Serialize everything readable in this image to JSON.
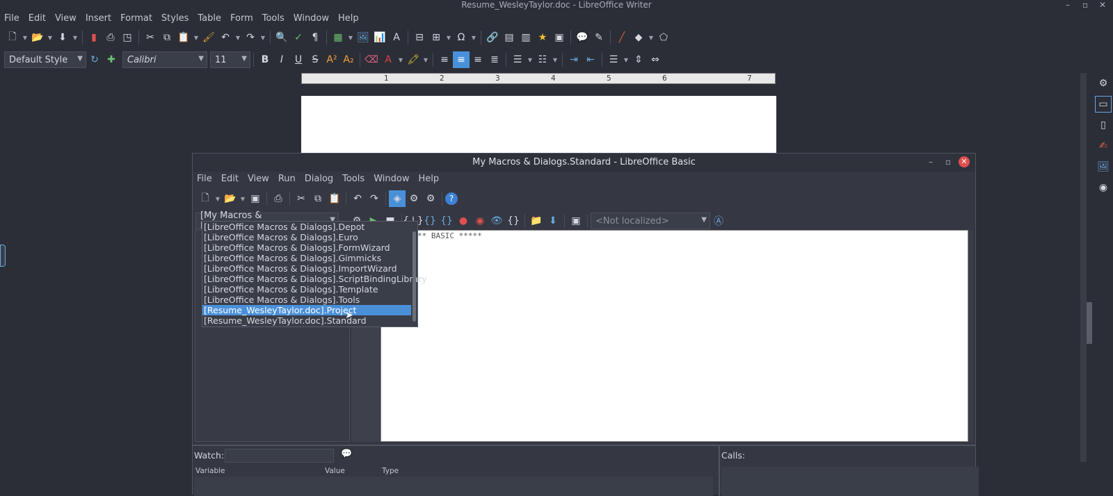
{
  "writer": {
    "title": "Resume_WesleyTaylor.doc - LibreOffice Writer",
    "menu": [
      "File",
      "Edit",
      "View",
      "Insert",
      "Format",
      "Styles",
      "Table",
      "Form",
      "Tools",
      "Window",
      "Help"
    ],
    "style_value": "Default Style",
    "font_value": "Calibri",
    "size_value": "11",
    "ruler_numbers": [
      "1",
      "2",
      "3",
      "4",
      "5",
      "6",
      "7"
    ],
    "window_controls": [
      "–",
      "▫",
      "✕"
    ]
  },
  "basic_ide": {
    "title": "My Macros & Dialogs.Standard - LibreOffice Basic",
    "menu": [
      "File",
      "Edit",
      "View",
      "Run",
      "Dialog",
      "Tools",
      "Window",
      "Help"
    ],
    "library_value": "[My Macros & Dialogs].Standa",
    "language_placeholder": "<Not localized>",
    "library_options": [
      "[LibreOffice Macros & Dialogs].Depot",
      "[LibreOffice Macros & Dialogs].Euro",
      "[LibreOffice Macros & Dialogs].FormWizard",
      "[LibreOffice Macros & Dialogs].Gimmicks",
      "[LibreOffice Macros & Dialogs].ImportWizard",
      "[LibreOffice Macros & Dialogs].ScriptBindingLibrary",
      "[LibreOffice Macros & Dialogs].Template",
      "[LibreOffice Macros & Dialogs].Tools",
      "[Resume_WesleyTaylor.doc].Project",
      "[Resume_WesleyTaylor.doc].Standard"
    ],
    "selected_index": 8,
    "code_line": "**  BASIC  *****",
    "watch_label": "Watch:",
    "calls_label": "Calls:",
    "col_variable": "Variable",
    "col_value": "Value",
    "col_type": "Type"
  }
}
